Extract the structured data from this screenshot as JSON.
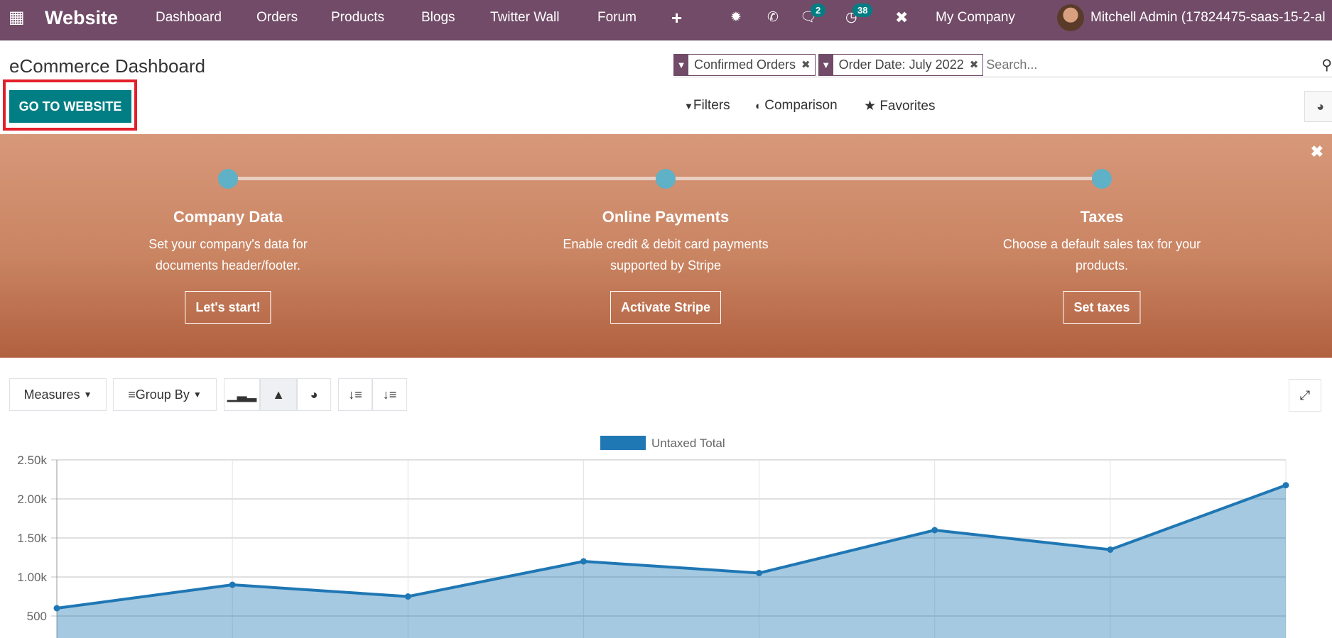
{
  "navbar": {
    "app": "Website",
    "menu": [
      "Dashboard",
      "Orders",
      "Products",
      "Blogs",
      "Twitter Wall",
      "Forum"
    ],
    "plus": "+",
    "messages_count": "2",
    "activities_count": "38",
    "company": "My Company",
    "user": "Mitchell Admin (17824475-saas-15-2-al"
  },
  "header": {
    "title": "eCommerce Dashboard",
    "go_to_website": "GO TO WEBSITE"
  },
  "search": {
    "facets": [
      {
        "label": "Confirmed Orders"
      },
      {
        "label": "Order Date: July 2022"
      }
    ],
    "placeholder": "Search...",
    "filters": "Filters",
    "comparison": "Comparison",
    "favorites": "Favorites"
  },
  "onboarding": {
    "steps": [
      {
        "title": "Company Data",
        "line1": "Set your company's data for",
        "line2": "documents header/footer.",
        "button": "Let's start!"
      },
      {
        "title": "Online Payments",
        "line1": "Enable credit & debit card payments",
        "line2": "supported by Stripe",
        "button": "Activate Stripe"
      },
      {
        "title": "Taxes",
        "line1": "Choose a default sales tax for your",
        "line2": "products.",
        "button": "Set taxes"
      }
    ]
  },
  "toolbar": {
    "measures": "Measures",
    "group_by": "Group By",
    "active_chart": "line"
  },
  "colors": {
    "navbar": "#714b67",
    "primary": "#017e84",
    "series": "#1f77b4",
    "highlight": "#e3202a"
  },
  "chart_data": {
    "type": "area",
    "legend": [
      "Untaxed Total"
    ],
    "legend_position": "top",
    "grid": true,
    "yticks": [
      "500",
      "1.00k",
      "1.50k",
      "2.00k",
      "2.50k"
    ],
    "ylim": [
      0,
      2500
    ],
    "series": [
      {
        "name": "Untaxed Total",
        "values": [
          600,
          900,
          750,
          1200,
          1050,
          1600,
          1350,
          2175
        ]
      }
    ]
  }
}
